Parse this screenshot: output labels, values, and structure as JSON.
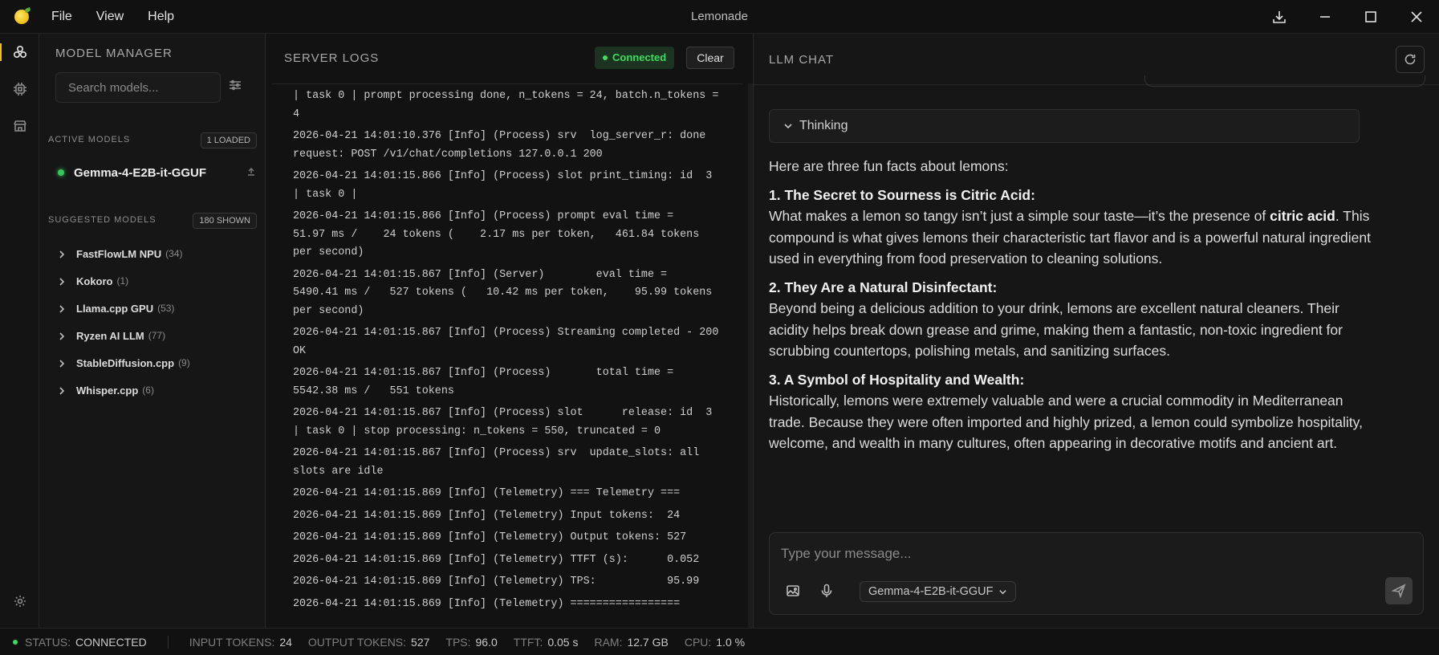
{
  "window": {
    "title": "Lemonade"
  },
  "menu": [
    "File",
    "View",
    "Help"
  ],
  "model_manager": {
    "title": "MODEL MANAGER",
    "search_placeholder": "Search models...",
    "active_label": "ACTIVE MODELS",
    "active_badge": "1 LOADED",
    "active_models": [
      {
        "name": "Gemma-4-E2B-it-GGUF",
        "status_color": "#35c759"
      }
    ],
    "suggested_label": "SUGGESTED MODELS",
    "suggested_badge": "180 SHOWN",
    "categories": [
      {
        "name": "FastFlowLM NPU",
        "count": "(34)"
      },
      {
        "name": "Kokoro",
        "count": "(1)"
      },
      {
        "name": "Llama.cpp GPU",
        "count": "(53)"
      },
      {
        "name": "Ryzen AI LLM",
        "count": "(77)"
      },
      {
        "name": "StableDiffusion.cpp",
        "count": "(9)"
      },
      {
        "name": "Whisper.cpp",
        "count": "(6)"
      }
    ]
  },
  "server_logs": {
    "title": "SERVER LOGS",
    "status": "Connected",
    "clear_label": "Clear",
    "lines": [
      "| task 0 | prompt processing done, n_tokens = 24, batch.n_tokens = 4",
      "2026-04-21 14:01:10.376 [Info] (Process) srv  log_server_r: done request: POST /v1/chat/completions 127.0.0.1 200",
      "2026-04-21 14:01:15.866 [Info] (Process) slot print_timing: id  3 | task 0 |",
      "2026-04-21 14:01:15.866 [Info] (Process) prompt eval time =     51.97 ms /    24 tokens (    2.17 ms per token,   461.84 tokens per second)",
      "2026-04-21 14:01:15.867 [Info] (Server)        eval time =    5490.41 ms /   527 tokens (   10.42 ms per token,    95.99 tokens per second)",
      "2026-04-21 14:01:15.867 [Info] (Process) Streaming completed - 200 OK",
      "2026-04-21 14:01:15.867 [Info] (Process)       total time =    5542.38 ms /   551 tokens",
      "2026-04-21 14:01:15.867 [Info] (Process) slot      release: id  3 | task 0 | stop processing: n_tokens = 550, truncated = 0",
      "2026-04-21 14:01:15.867 [Info] (Process) srv  update_slots: all slots are idle",
      "2026-04-21 14:01:15.869 [Info] (Telemetry) === Telemetry ===",
      "2026-04-21 14:01:15.869 [Info] (Telemetry) Input tokens:  24",
      "2026-04-21 14:01:15.869 [Info] (Telemetry) Output tokens: 527",
      "2026-04-21 14:01:15.869 [Info] (Telemetry) TTFT (s):      0.052",
      "2026-04-21 14:01:15.869 [Info] (Telemetry) TPS:           95.99",
      "2026-04-21 14:01:15.869 [Info] (Telemetry) ================="
    ]
  },
  "chat": {
    "title": "LLM CHAT",
    "thinking_label": "Thinking",
    "intro": "Here are three fun facts about lemons:",
    "facts": [
      {
        "heading": "1. The Secret to Sourness is Citric Acid:",
        "body_before": "What makes a lemon so tangy isn’t just a simple sour taste—it’s the presence of ",
        "body_bold": "citric acid",
        "body_after": ". This compound is what gives lemons their characteristic tart flavor and is a powerful natural ingredient used in everything from food preservation to cleaning solutions."
      },
      {
        "heading": "2. They Are a Natural Disinfectant:",
        "body": "Beyond being a delicious addition to your drink, lemons are excellent natural cleaners. Their acidity helps break down grease and grime, making them a fantastic, non-toxic ingredient for scrubbing countertops, polishing metals, and sanitizing surfaces."
      },
      {
        "heading": "3. A Symbol of Hospitality and Wealth:",
        "body": "Historically, lemons were extremely valuable and were a crucial commodity in Mediterranean trade. Because they were often imported and highly prized, a lemon could symbolize hospitality, welcome, and wealth in many cultures, often appearing in decorative motifs and ancient art."
      }
    ],
    "input_placeholder": "Type your message...",
    "selected_model": "Gemma-4-E2B-it-GGUF"
  },
  "status_bar": {
    "status_label": "STATUS:",
    "status_value": "CONNECTED",
    "input_tokens_label": "INPUT TOKENS:",
    "input_tokens": "24",
    "output_tokens_label": "OUTPUT TOKENS:",
    "output_tokens": "527",
    "tps_label": "TPS:",
    "tps": "96.0",
    "ttft_label": "TTFT:",
    "ttft": "0.05 s",
    "ram_label": "RAM:",
    "ram": "12.7 GB",
    "cpu_label": "CPU:",
    "cpu": "1.0 %"
  },
  "colors": {
    "accent": "#f1c21b",
    "connected": "#3ddc5f"
  }
}
